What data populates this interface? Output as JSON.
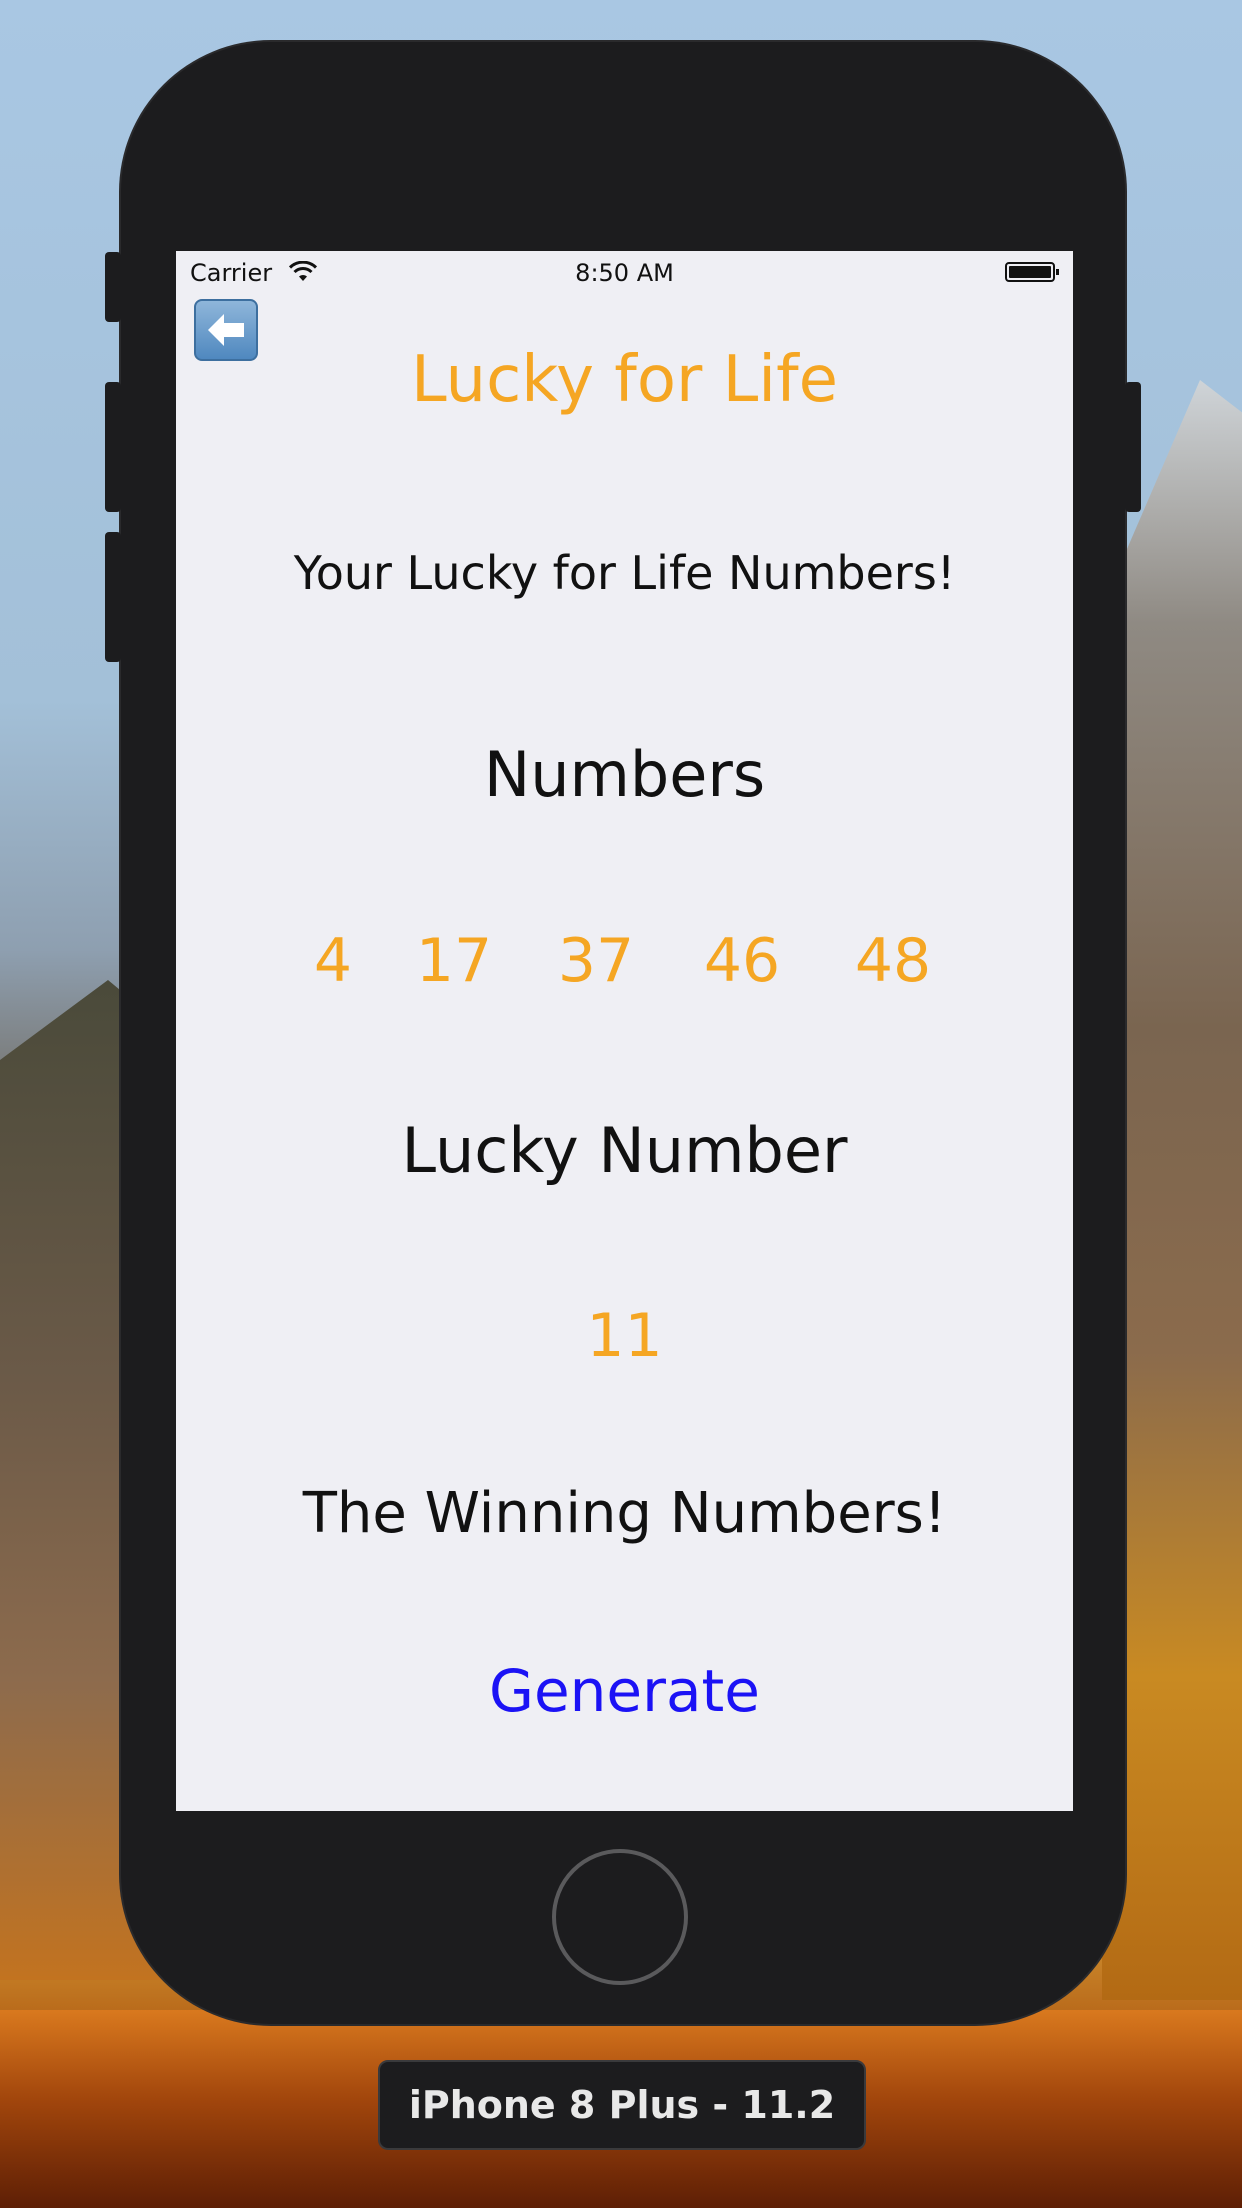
{
  "status_bar": {
    "carrier": "Carrier",
    "time": "8:50 AM",
    "icons": [
      "wifi-icon",
      "battery-icon"
    ]
  },
  "nav": {
    "back_icon": "back-arrow-icon"
  },
  "screen": {
    "title": "Lucky for Life",
    "subtitle": "Your Lucky for Life Numbers!",
    "numbers_heading": "Numbers",
    "numbers": [
      "4",
      "17",
      "37",
      "46",
      "48"
    ],
    "lucky_heading": "Lucky Number",
    "lucky_number": "11",
    "winning_label": "The Winning Numbers!",
    "generate_label": "Generate"
  },
  "simulator": {
    "device_label": "iPhone 8 Plus - 11.2"
  },
  "colors": {
    "accent": "#f5a623",
    "link": "#1b12f5",
    "screen_bg": "#efeff4",
    "device_body": "#1c1c1e"
  }
}
